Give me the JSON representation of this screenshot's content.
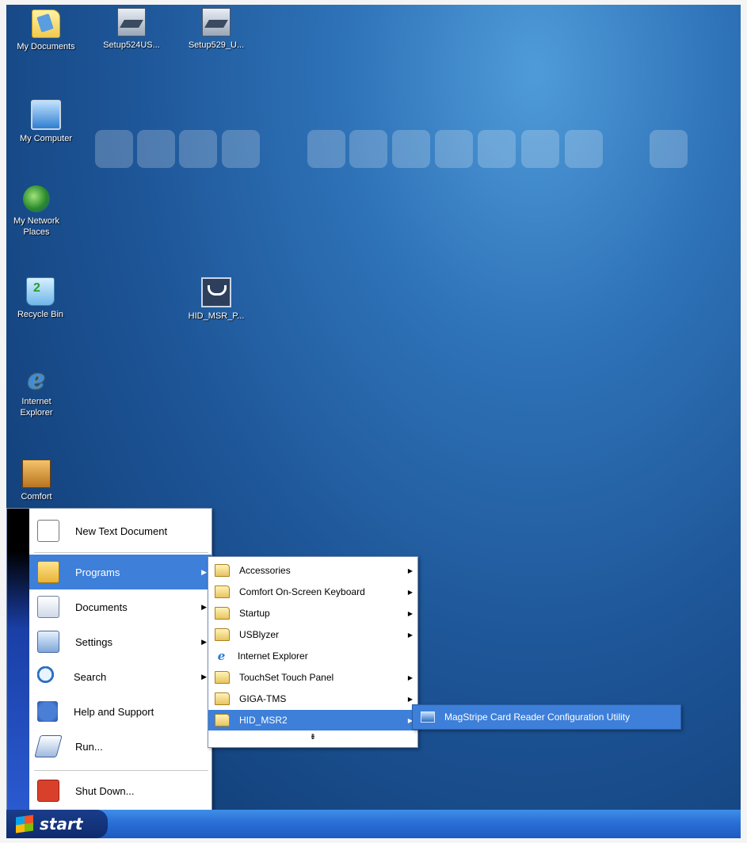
{
  "desktop": {
    "icons": [
      {
        "label": "My Documents",
        "icon": "my-documents-icon"
      },
      {
        "label": "Setup524US...",
        "icon": "setup-icon"
      },
      {
        "label": "Setup529_U...",
        "icon": "setup-icon"
      },
      {
        "label": "My Computer",
        "icon": "my-computer-icon"
      },
      {
        "label": "My Network Places",
        "icon": "network-places-icon"
      },
      {
        "label": "Recycle Bin",
        "icon": "recycle-bin-icon"
      },
      {
        "label": "HID_MSR_P...",
        "icon": "hid-msr-icon"
      },
      {
        "label": "Internet Explorer",
        "icon": "internet-explorer-icon"
      },
      {
        "label": "Comfort",
        "icon": "comfort-keyboard-icon"
      }
    ]
  },
  "start_menu": {
    "items": [
      {
        "label": "New Text Document",
        "icon": "text-document-icon"
      },
      {
        "label": "Programs",
        "icon": "programs-folder-icon",
        "submenu": true
      },
      {
        "label": "Documents",
        "icon": "documents-icon",
        "submenu": true
      },
      {
        "label": "Settings",
        "icon": "settings-icon",
        "submenu": true
      },
      {
        "label": "Search",
        "icon": "search-icon",
        "submenu": true
      },
      {
        "label": "Help and Support",
        "icon": "help-icon"
      },
      {
        "label": "Run...",
        "icon": "run-icon"
      },
      {
        "label": "Shut Down...",
        "icon": "shutdown-icon"
      }
    ]
  },
  "programs_menu": {
    "items": [
      {
        "label": "Accessories",
        "submenu": true
      },
      {
        "label": "Comfort On-Screen Keyboard",
        "submenu": true
      },
      {
        "label": "Startup",
        "submenu": true
      },
      {
        "label": "USBlyzer",
        "submenu": true
      },
      {
        "label": "Internet Explorer",
        "submenu": false
      },
      {
        "label": "TouchSet Touch Panel",
        "submenu": true
      },
      {
        "label": "GIGA-TMS",
        "submenu": true
      },
      {
        "label": "HID_MSR2",
        "submenu": true
      }
    ],
    "expander": "⇟"
  },
  "hid_menu": {
    "items": [
      {
        "label": "MagStripe Card Reader Configuration Utility",
        "icon": "utility-icon"
      }
    ]
  },
  "taskbar": {
    "start_label": "start"
  },
  "glyphs": {
    "arrow": "▶"
  }
}
